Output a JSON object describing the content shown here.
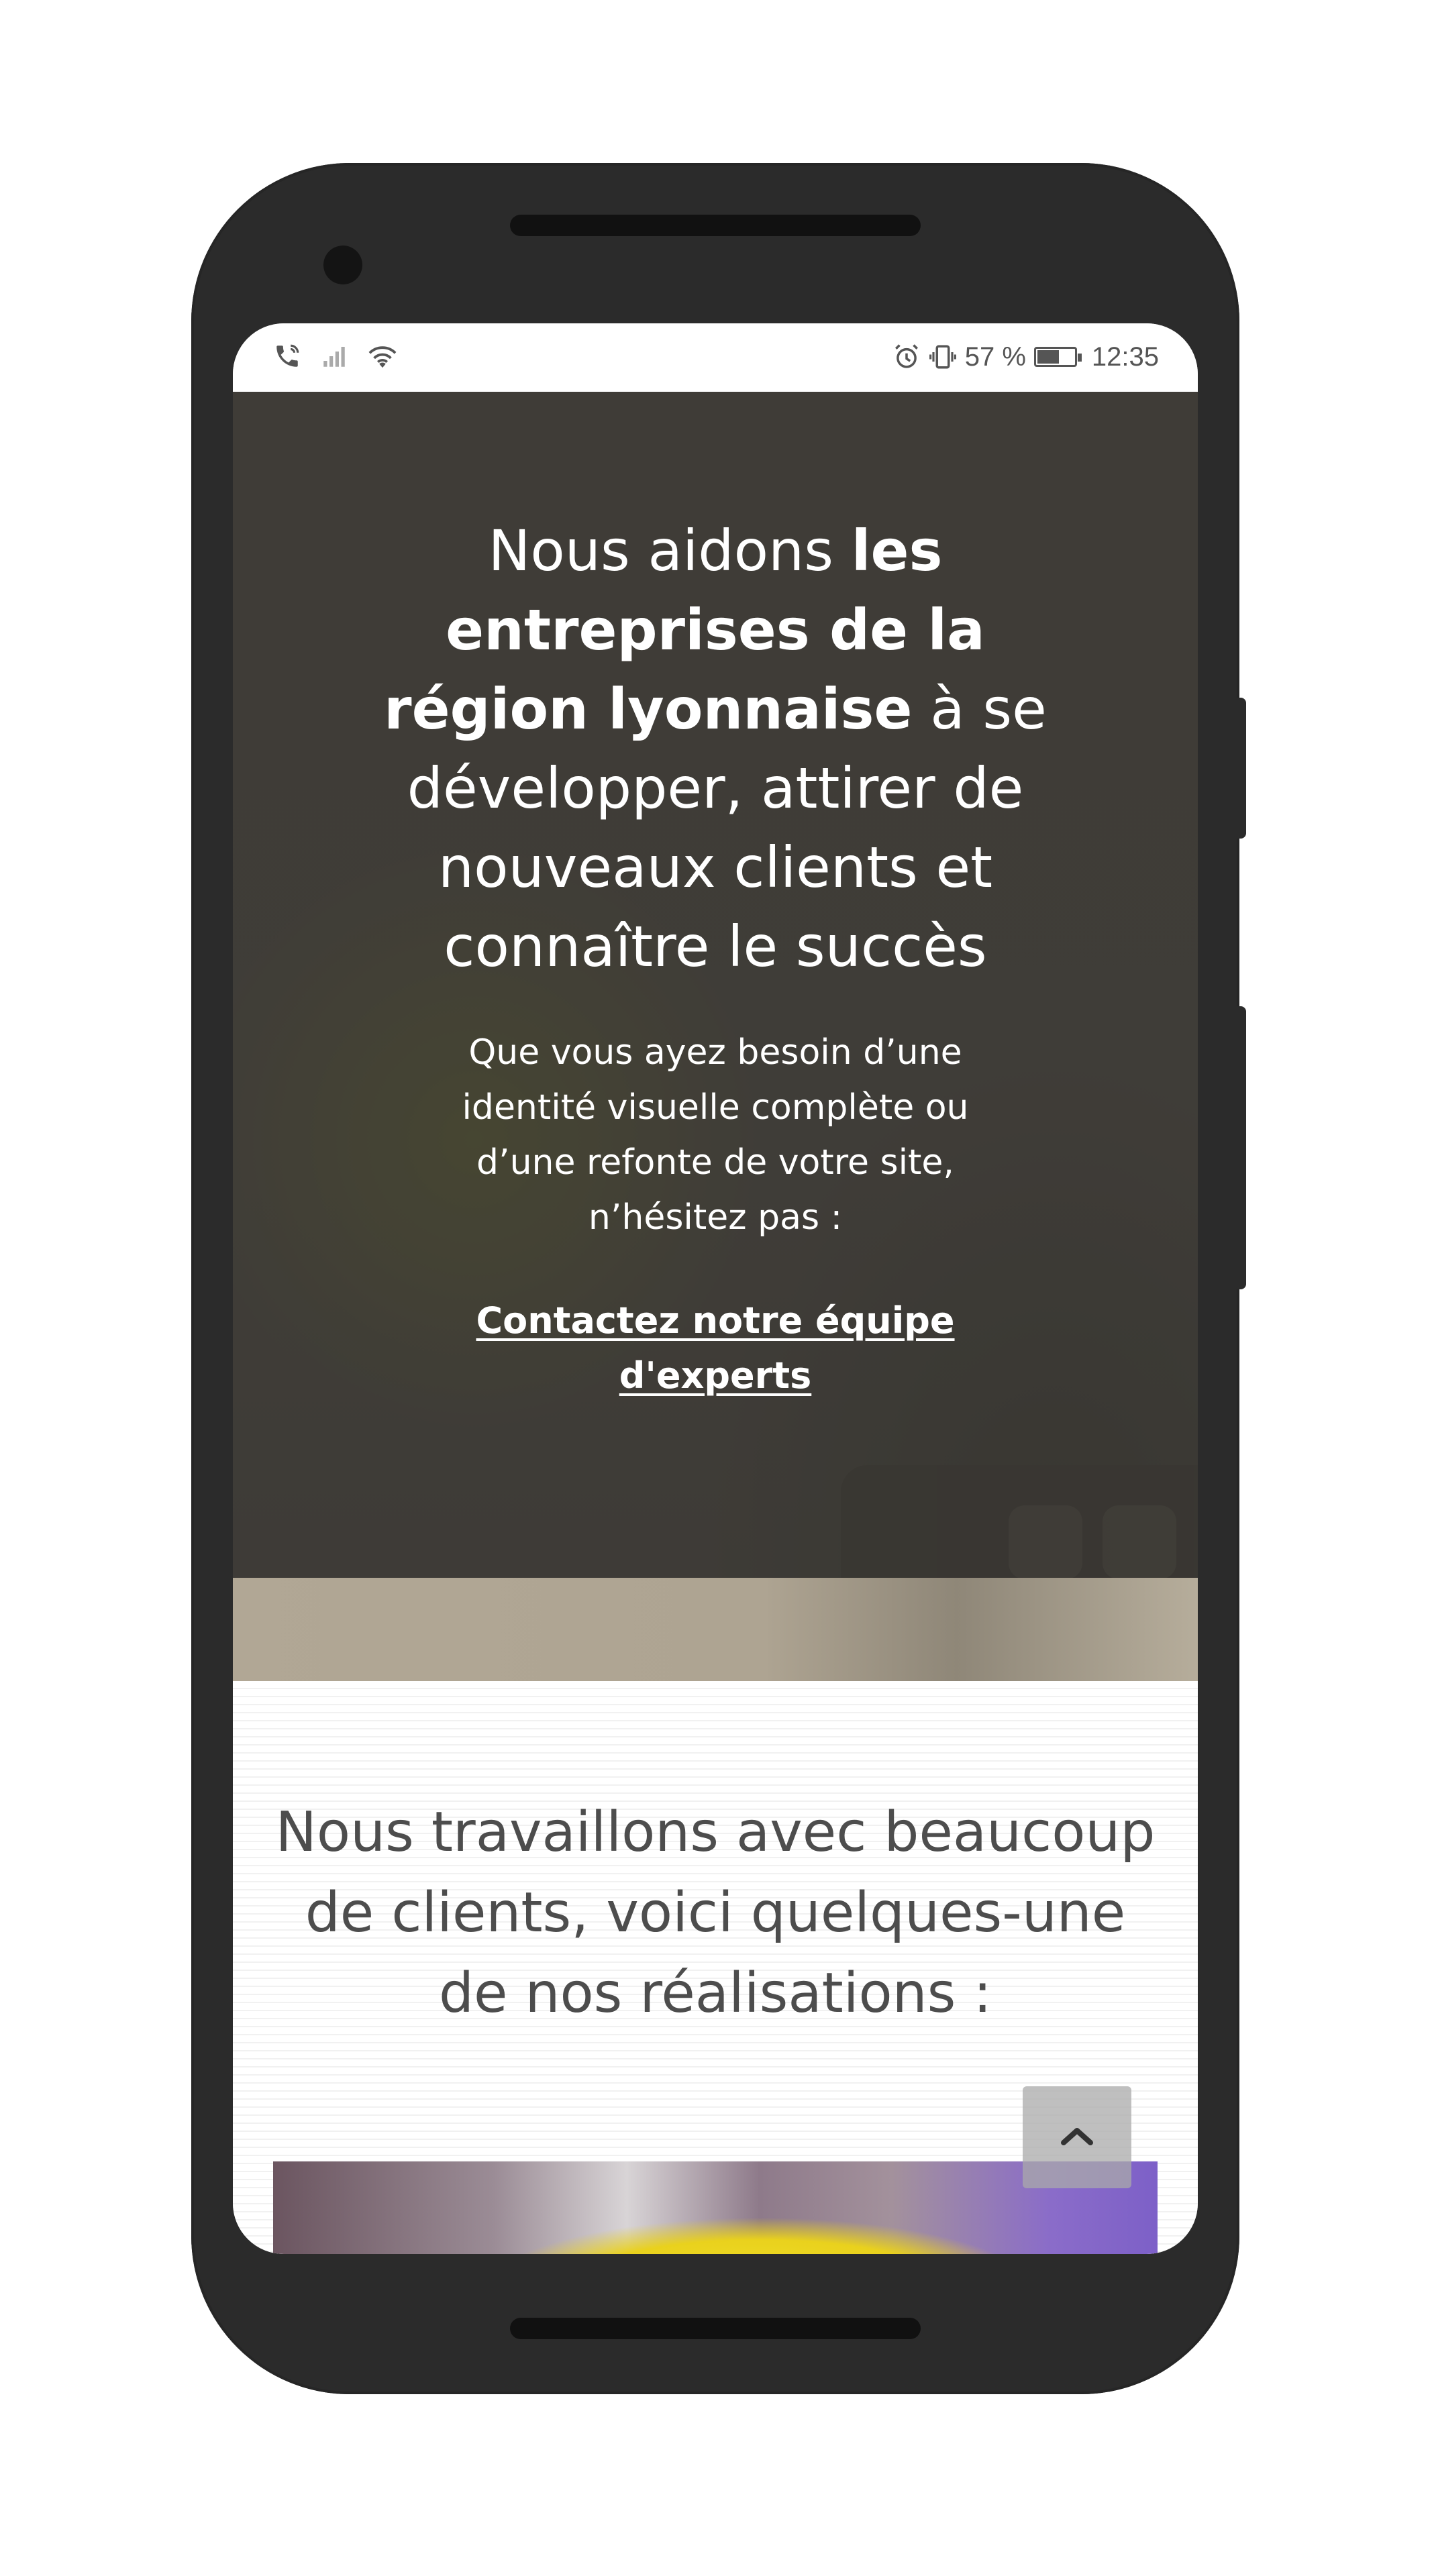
{
  "status_bar": {
    "battery": "57 %",
    "time": "12:35",
    "icons": [
      "phone-call-icon",
      "signal-icon",
      "wifi-icon",
      "alarm-icon",
      "vibrate-icon",
      "battery-icon"
    ]
  },
  "hero": {
    "title_part1": "Nous aidons ",
    "title_bold": "les entreprises de la région lyonnaise",
    "title_part2": " à se développer, attirer de nouveaux clients et connaître le succès",
    "subtitle": "Que vous ayez besoin d’une identité visuelle complète ou d’une refonte de votre site, n’hésitez pas :",
    "cta_label": "Contactez notre équipe d'experts"
  },
  "clients_section": {
    "title": "Nous travaillons avec beaucoup de clients, voici quelques-une de nos réalisations :"
  },
  "scroll_top": {
    "icon": "chevron-up-icon"
  },
  "colors": {
    "device": "#2b2b2b",
    "hero_overlay": "#373430",
    "section_text": "#4d4d4d",
    "scroll_button": "#aaaaaa"
  }
}
